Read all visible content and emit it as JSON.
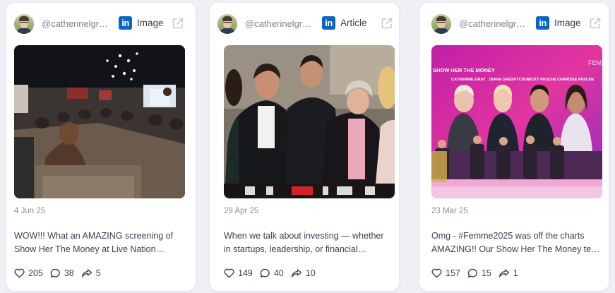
{
  "posts": [
    {
      "handle": "@catherinelgr…",
      "network_icon": "linkedin-icon",
      "type": "Image",
      "date": "4 Jun 25",
      "text_line1": "WOW!!! What an AMAZING screening of",
      "text_line2": "Show Her The Money at Live Nation…",
      "likes": "205",
      "comments": "38",
      "shares": "5"
    },
    {
      "handle": "@catherinelgr…",
      "network_icon": "linkedin-icon",
      "type": "Article",
      "date": "29 Apr 25",
      "text_line1": "When we talk about investing — whether",
      "text_line2": "in startups, leadership, or financial…",
      "likes": "149",
      "comments": "40",
      "shares": "10"
    },
    {
      "handle": "@catherinelgr…",
      "network_icon": "linkedin-icon",
      "type": "Image",
      "date": "23 Mar 25",
      "text_line1": "Omg - #Femme2025 was off the charts",
      "text_line2": "AMAZING!! Our Show Her The Money tea…",
      "likes": "157",
      "comments": "15",
      "shares": "1",
      "media_banner": "SHOW HER THE MONEY",
      "media_names": [
        "CATHERINE GRAY",
        "DIANA GRESHTCHUK",
        "VICKY PASCHE",
        "CHARISSE PASCHE"
      ]
    }
  ],
  "colors": {
    "background": "#eef0f5",
    "card": "#ffffff",
    "linkedin": "#0a66c2",
    "muted_text": "#8a90a0",
    "body_text": "#3c4254"
  },
  "linkedin_label": "in"
}
